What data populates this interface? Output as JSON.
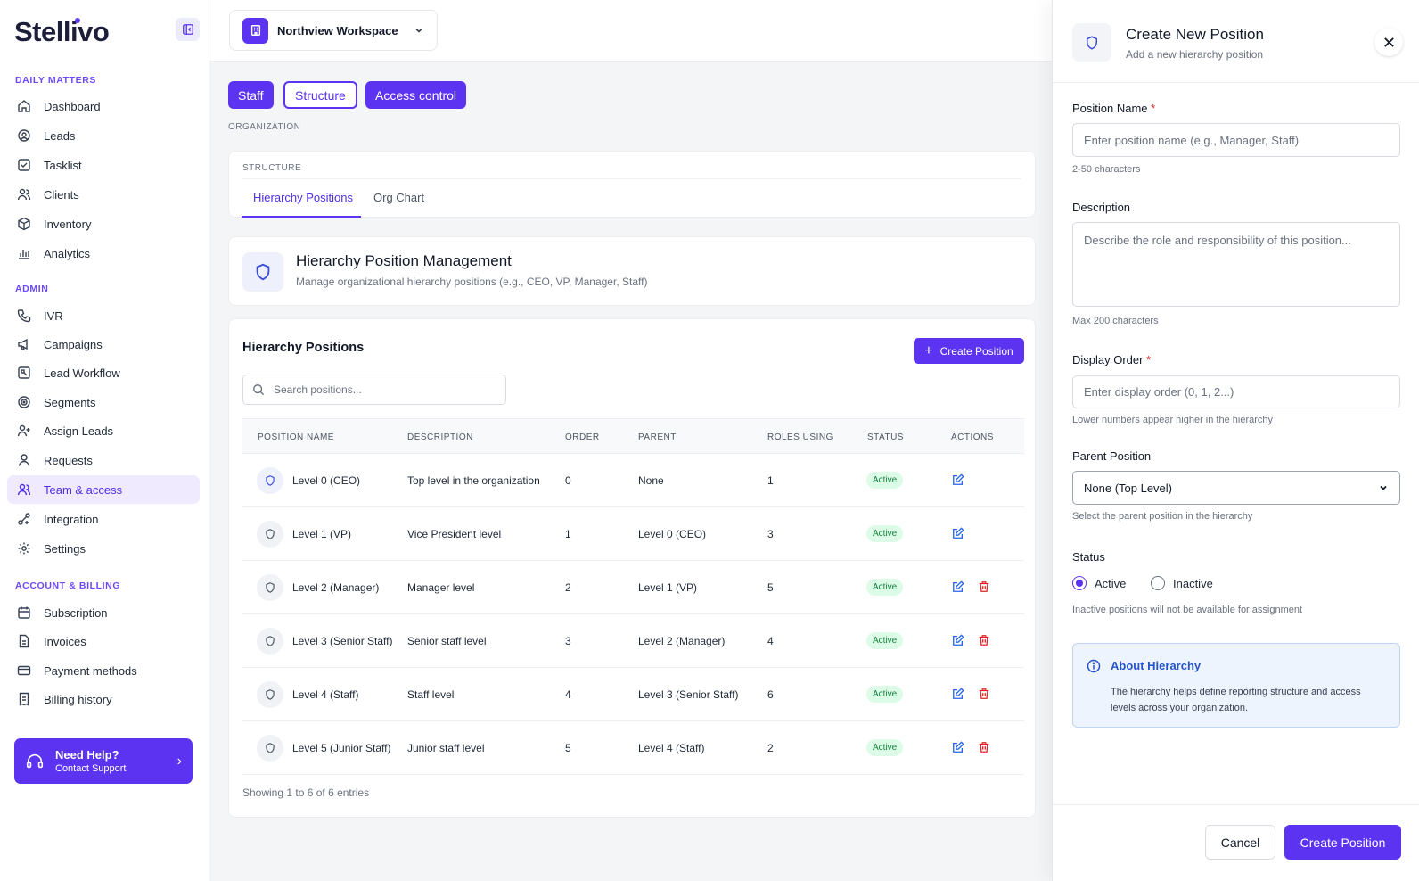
{
  "brand": {
    "name": "Stellivo"
  },
  "sidebar": {
    "sections": [
      {
        "label": "DAILY MATTERS"
      },
      {
        "label": "ADMIN"
      },
      {
        "label": "ACCOUNT & BILLING"
      }
    ],
    "items": [
      {
        "label": "Dashboard",
        "icon": "home-icon"
      },
      {
        "label": "Leads",
        "icon": "user-circle-icon"
      },
      {
        "label": "Tasklist",
        "icon": "check-square-icon"
      },
      {
        "label": "Clients",
        "icon": "users-icon"
      },
      {
        "label": "Inventory",
        "icon": "box-icon"
      },
      {
        "label": "Analytics",
        "icon": "bar-chart-icon"
      },
      {
        "label": "IVR",
        "icon": "phone-icon"
      },
      {
        "label": "Campaigns",
        "icon": "megaphone-icon"
      },
      {
        "label": "Lead Workflow",
        "icon": "workflow-icon"
      },
      {
        "label": "Segments",
        "icon": "target-icon"
      },
      {
        "label": "Assign Leads",
        "icon": "user-plus-icon"
      },
      {
        "label": "Requests",
        "icon": "user-icon"
      },
      {
        "label": "Team & access",
        "icon": "users-icon"
      },
      {
        "label": "Integration",
        "icon": "plug-icon"
      },
      {
        "label": "Settings",
        "icon": "gear-icon"
      },
      {
        "label": "Subscription",
        "icon": "calendar-icon"
      },
      {
        "label": "Invoices",
        "icon": "file-icon"
      },
      {
        "label": "Payment methods",
        "icon": "credit-card-icon"
      },
      {
        "label": "Billing history",
        "icon": "receipt-icon"
      }
    ],
    "help": {
      "title": "Need Help?",
      "subtitle": "Contact Support"
    }
  },
  "topbar": {
    "workspace": "Northview Workspace"
  },
  "main": {
    "tabs": [
      {
        "label": "Staff"
      },
      {
        "label": "Structure"
      },
      {
        "label": "Access control"
      }
    ],
    "breadcrumb": "ORGANIZATION",
    "structure": {
      "label": "STRUCTURE",
      "subtabs": [
        {
          "label": "Hierarchy Positions"
        },
        {
          "label": "Org Chart"
        }
      ]
    },
    "management": {
      "title": "Hierarchy Position Management",
      "subtitle": "Manage organizational hierarchy positions (e.g., CEO, VP, Manager, Staff)"
    },
    "table": {
      "title": "Hierarchy Positions",
      "create_label": "Create Position",
      "search_placeholder": "Search positions...",
      "columns": [
        "POSITION NAME",
        "DESCRIPTION",
        "ORDER",
        "PARENT",
        "ROLES USING",
        "STATUS",
        "ACTIONS"
      ],
      "rows": [
        {
          "name": "Level 0 (CEO)",
          "description": "Top level in the organization",
          "order": "0",
          "parent": "None",
          "roles": "1",
          "status": "Active"
        },
        {
          "name": "Level 1 (VP)",
          "description": "Vice President level",
          "order": "1",
          "parent": "Level 0 (CEO)",
          "roles": "3",
          "status": "Active"
        },
        {
          "name": "Level 2 (Manager)",
          "description": "Manager level",
          "order": "2",
          "parent": "Level 1 (VP)",
          "roles": "5",
          "status": "Active"
        },
        {
          "name": "Level 3 (Senior Staff)",
          "description": "Senior staff level",
          "order": "3",
          "parent": "Level 2 (Manager)",
          "roles": "4",
          "status": "Active"
        },
        {
          "name": "Level 4 (Staff)",
          "description": "Staff level",
          "order": "4",
          "parent": "Level 3 (Senior Staff)",
          "roles": "6",
          "status": "Active"
        },
        {
          "name": "Level 5 (Junior Staff)",
          "description": "Junior staff level",
          "order": "5",
          "parent": "Level 4 (Staff)",
          "roles": "2",
          "status": "Active"
        }
      ],
      "footer": "Showing 1 to 6 of 6 entries"
    }
  },
  "drawer": {
    "title": "Create New Position",
    "subtitle": "Add a new hierarchy position",
    "position_name": {
      "label": "Position Name",
      "required": "*",
      "placeholder": "Enter position name (e.g., Manager, Staff)",
      "hint": "2-50 characters"
    },
    "description": {
      "label": "Description",
      "placeholder": "Describe the role and responsibility of this position...",
      "hint": "Max 200 characters"
    },
    "display_order": {
      "label": "Display Order",
      "required": "*",
      "placeholder": "Enter display order (0, 1, 2...)",
      "hint": "Lower numbers appear higher in the hierarchy"
    },
    "parent": {
      "label": "Parent Position",
      "value": "None (Top Level)",
      "hint": "Select the parent position in the hierarchy"
    },
    "status": {
      "label": "Status",
      "options": [
        "Active",
        "Inactive"
      ],
      "selected": "Active",
      "hint": "Inactive positions will not be available for assignment"
    },
    "about": {
      "title": "About Hierarchy",
      "text": "The hierarchy helps define reporting structure and access levels across your organization."
    },
    "cancel_label": "Cancel",
    "submit_label": "Create Position"
  },
  "colors": {
    "accent": "#5b33f0",
    "success": "#15803d",
    "danger": "#dc2626",
    "info": "#2554c7"
  }
}
